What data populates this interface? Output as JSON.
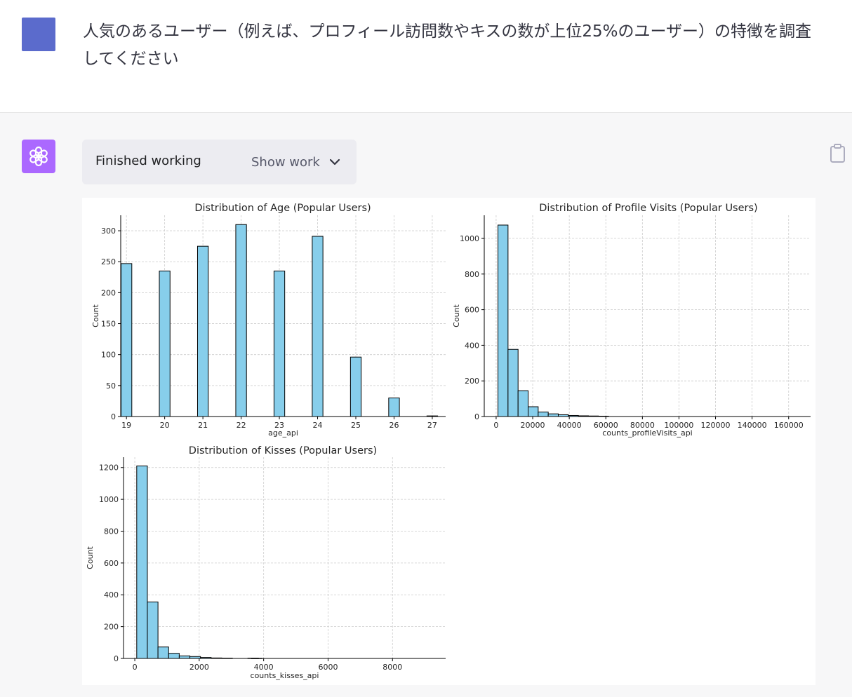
{
  "colors": {
    "user_avatar": "#5b6bcc",
    "assistant_avatar": "#ab68ff",
    "bar_fill": "#87ceeb",
    "bar_edge": "#000000"
  },
  "user_message": {
    "text": "人気のあるユーザー（例えば、プロフィール訪問数やキスの数が上位25%のユーザー）の特徴を調査してください"
  },
  "assistant": {
    "avatar_icon": "openai-logo-icon",
    "work_status": "Finished working",
    "show_work_label": "Show work",
    "toggle_icon": "chevron-down-icon",
    "copy_icon": "clipboard-icon"
  },
  "chart_data": [
    {
      "type": "bar",
      "title": "Distribution of Age (Popular Users)",
      "xlabel": "age_api",
      "ylabel": "Count",
      "x": [
        19,
        20,
        21,
        22,
        23,
        24,
        25,
        26,
        27
      ],
      "values": [
        247,
        235,
        275,
        310,
        235,
        291,
        96,
        30,
        1
      ],
      "xlim": [
        18.85,
        27.35
      ],
      "ylim": [
        0,
        325
      ],
      "xticks": [
        19,
        20,
        21,
        22,
        23,
        24,
        25,
        26,
        27
      ],
      "yticks": [
        0,
        50,
        100,
        150,
        200,
        250,
        300
      ],
      "grid": true
    },
    {
      "type": "bar",
      "title": "Distribution of Profile Visits (Popular Users)",
      "xlabel": "counts_profileVisits_api",
      "ylabel": "Count",
      "bin_starts": [
        1000,
        6500,
        12000,
        17500,
        23000,
        28500,
        34000,
        39500,
        45000,
        50500,
        56000
      ],
      "bin_width": 5500,
      "values": [
        1075,
        377,
        145,
        55,
        25,
        15,
        10,
        6,
        4,
        3,
        2
      ],
      "xlim": [
        -6500,
        172000
      ],
      "ylim": [
        0,
        1130
      ],
      "xticks": [
        0,
        20000,
        40000,
        60000,
        80000,
        100000,
        120000,
        140000,
        160000
      ],
      "yticks": [
        0,
        200,
        400,
        600,
        800,
        1000
      ],
      "grid": true
    },
    {
      "type": "bar",
      "title": "Distribution of Kisses (Popular Users)",
      "xlabel": "counts_kisses_api",
      "ylabel": "Count",
      "bin_starts": [
        60,
        390,
        720,
        1050,
        1380,
        1710,
        2040,
        2370,
        2700,
        3510,
        3620
      ],
      "bin_width": 330,
      "values": [
        1210,
        355,
        72,
        32,
        16,
        12,
        6,
        3,
        2,
        2,
        1
      ],
      "xlim": [
        -350,
        9650
      ],
      "ylim": [
        0,
        1265
      ],
      "xticks": [
        0,
        2000,
        4000,
        6000,
        8000
      ],
      "yticks": [
        0,
        200,
        400,
        600,
        800,
        1000,
        1200
      ],
      "grid": true
    }
  ]
}
